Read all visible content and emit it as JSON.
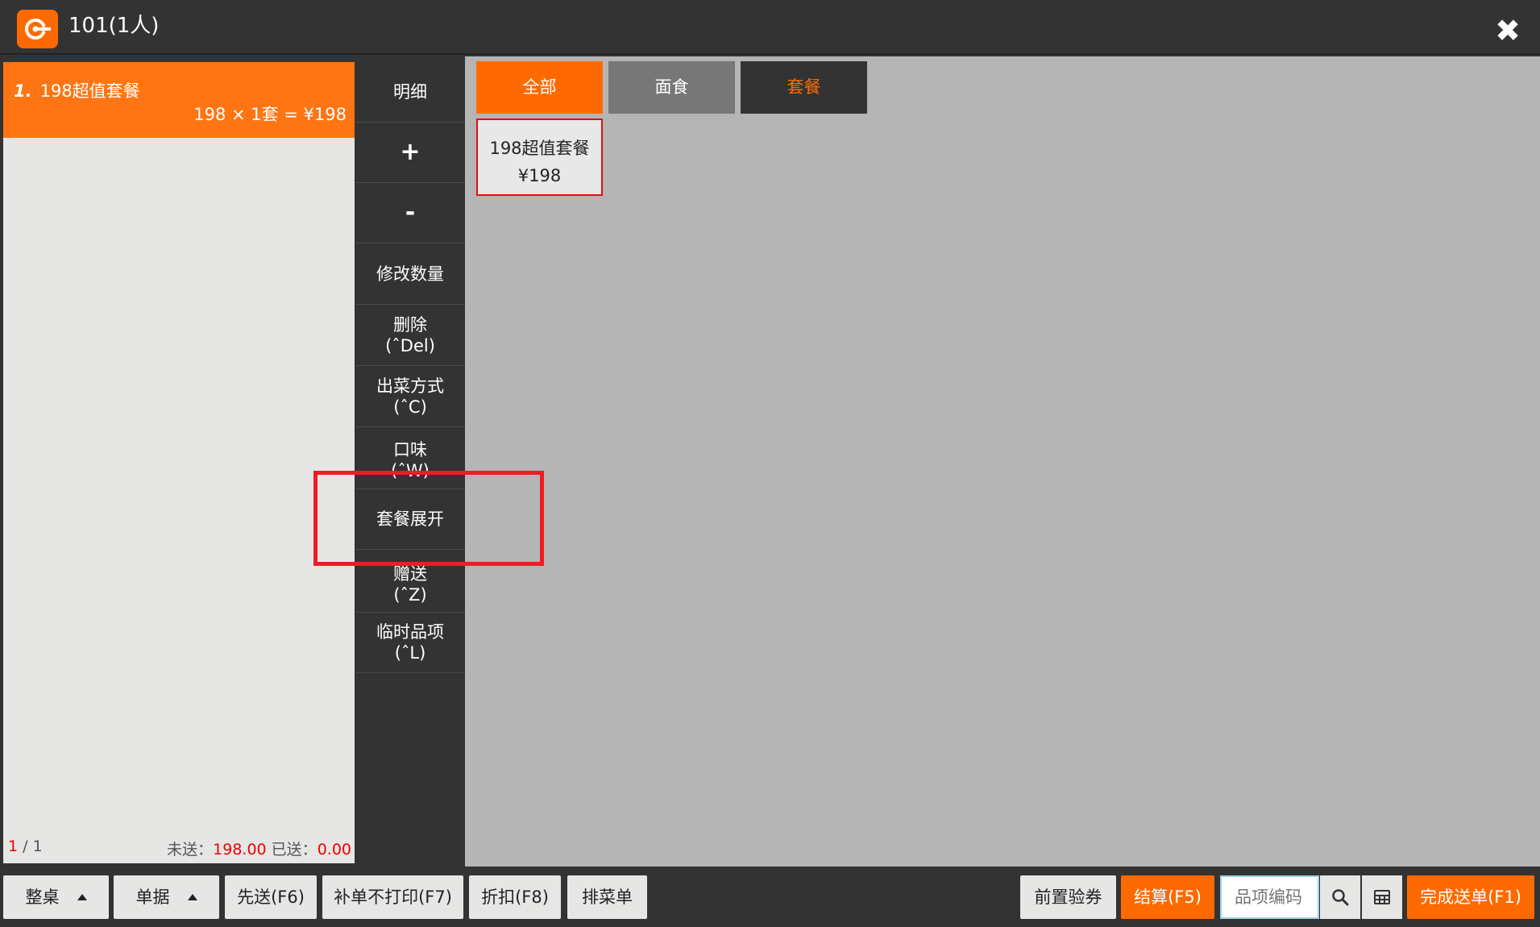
{
  "window": {
    "title": "101(1人)",
    "close_glyph": "✖"
  },
  "order": {
    "items": [
      {
        "index": "1.",
        "name": "198超值套餐",
        "calc": "198 × 1套 = ¥198"
      }
    ],
    "pager": {
      "current": "1",
      "sep_total": " / 1"
    },
    "sums": {
      "unsent_label": "未送：",
      "unsent_value": "198.00",
      "sent_label": " 已送：",
      "sent_value": "0.00"
    }
  },
  "actions": [
    {
      "label": "明细"
    },
    {
      "label": "+"
    },
    {
      "label": "-"
    },
    {
      "label": "修改数量"
    },
    {
      "label": "删除",
      "shortcut": "(ˆDel)"
    },
    {
      "label": "出菜方式",
      "shortcut": "(ˆC)"
    },
    {
      "label": "口味",
      "shortcut": "(ˆW)"
    },
    {
      "label": "套餐展开"
    },
    {
      "label": "赠送",
      "shortcut": "(ˆZ)"
    },
    {
      "label": "临时品项",
      "shortcut": "(ˆL)"
    }
  ],
  "categories": [
    {
      "label": "全部"
    },
    {
      "label": "面食"
    },
    {
      "label": "套餐"
    }
  ],
  "dishes": [
    {
      "name": "198超值套餐",
      "price": "¥198"
    }
  ],
  "toolbar": {
    "whole_table": "整桌",
    "documents": "单据",
    "send_first": "先送(F6)",
    "supplement_no_print": "补单不打印(F7)",
    "discount": "折扣(F8)",
    "sort_menu": "排菜单",
    "pre_verify_coupon": "前置验券",
    "checkout": "结算(F5)",
    "code_placeholder": "品项编码",
    "finish_send": "完成送单(F1)"
  },
  "colors": {
    "accent": "#ff6a00",
    "highlight": "#ee1c24",
    "dark": "#333333"
  }
}
